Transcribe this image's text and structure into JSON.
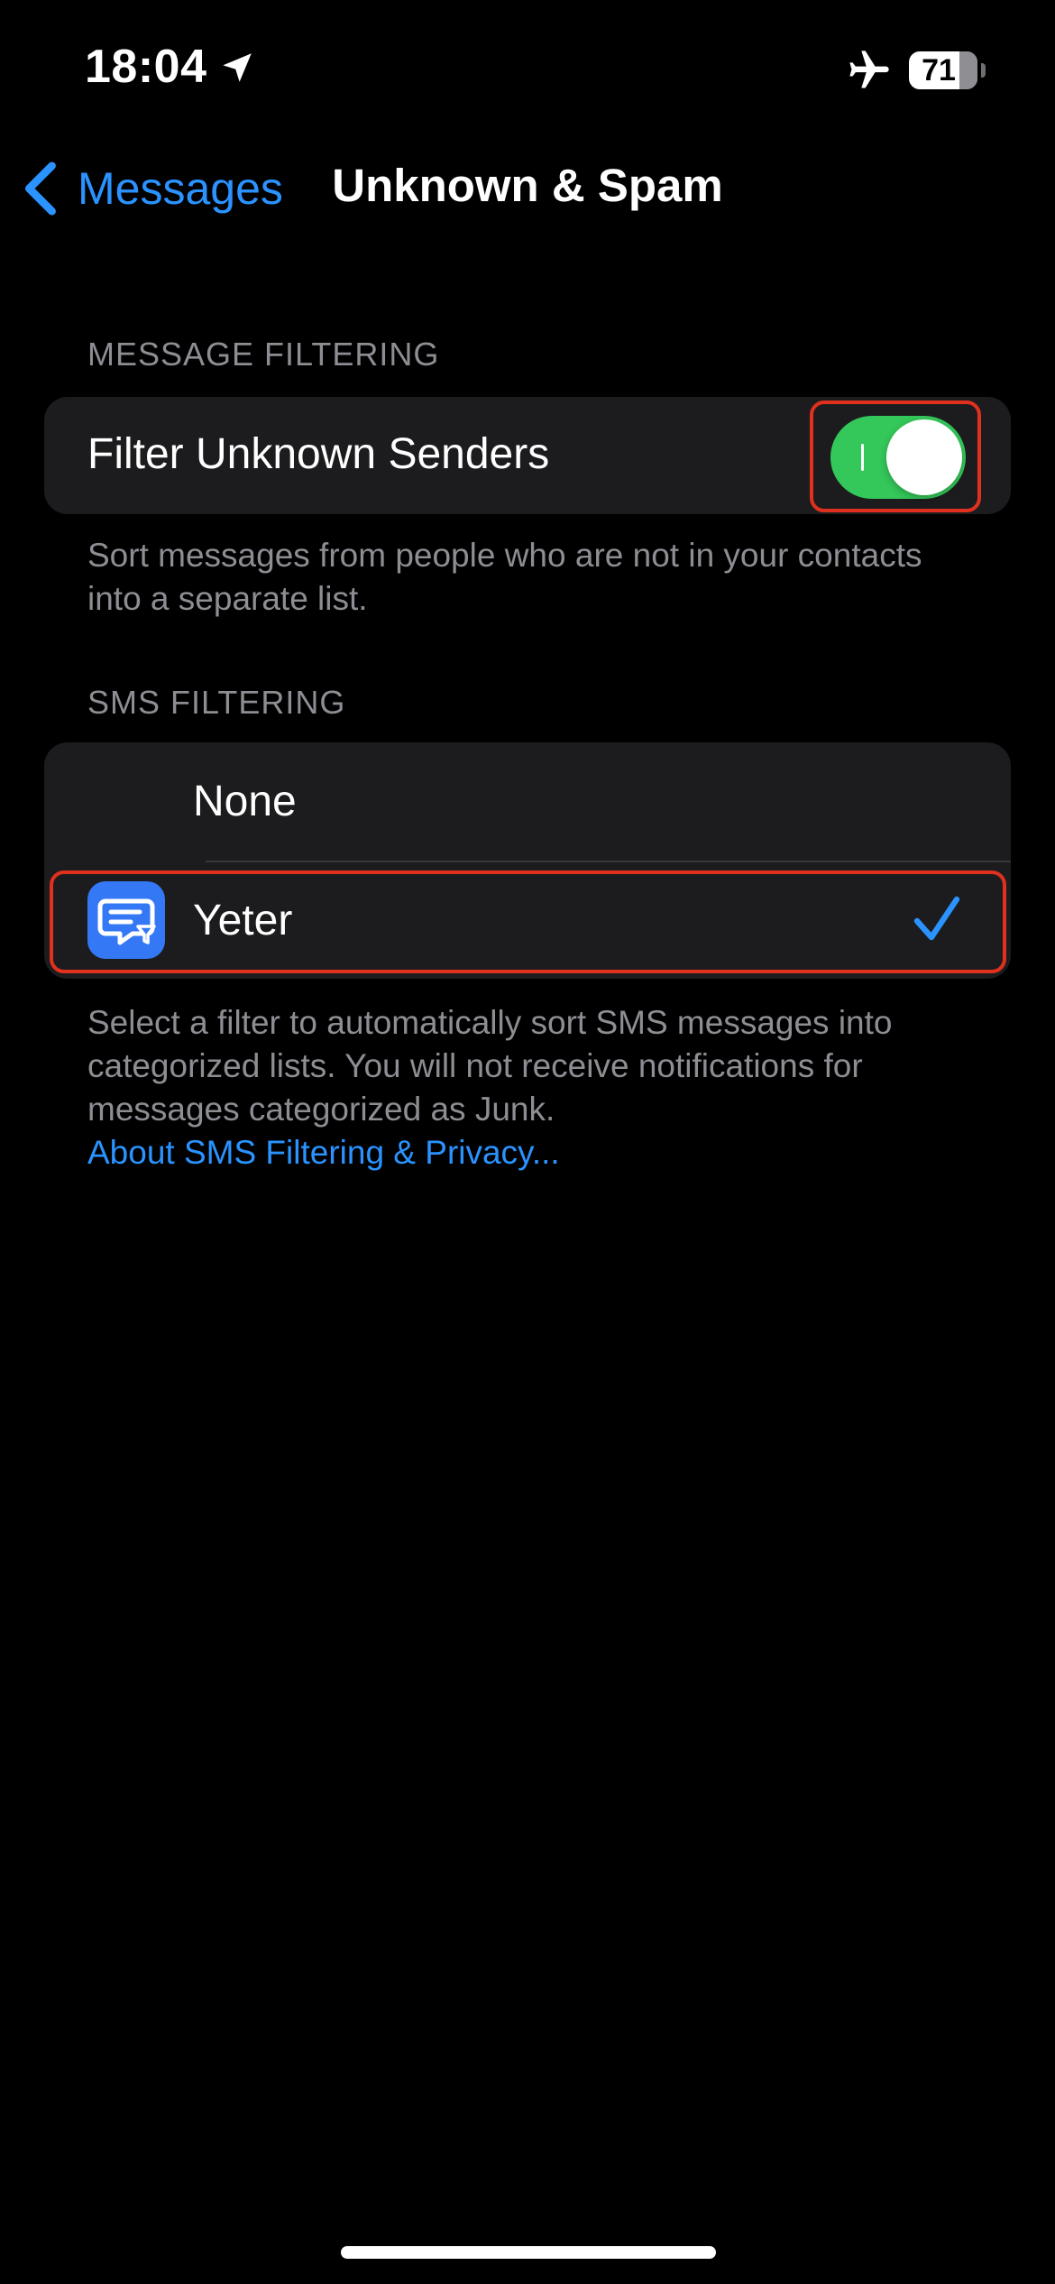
{
  "status_bar": {
    "time": "18:04",
    "battery_level": "71",
    "icons": [
      "location-arrow-icon",
      "airplane-icon",
      "battery-icon"
    ]
  },
  "nav": {
    "back_label": "Messages",
    "title": "Unknown & Spam"
  },
  "message_filtering": {
    "header": "MESSAGE FILTERING",
    "filter_unknown_label": "Filter Unknown Senders",
    "filter_unknown_enabled": true,
    "footer": "Sort messages from people who are not in your contacts into a separate list."
  },
  "sms_filtering": {
    "header": "SMS FILTERING",
    "options": [
      {
        "label": "None",
        "selected": false
      },
      {
        "label": "Yeter",
        "selected": true,
        "icon": "message-filter-icon"
      }
    ],
    "footer": "Select a filter to automatically sort SMS messages into categorized lists. You will not receive notifications for messages categorized as Junk.",
    "footer_link": "About SMS Filtering & Privacy..."
  },
  "colors": {
    "accent": "#2a93ff",
    "toggle_on": "#34c759",
    "highlight": "#e0301e",
    "group_background": "#1c1c1e",
    "app_icon": "#3478f6"
  }
}
